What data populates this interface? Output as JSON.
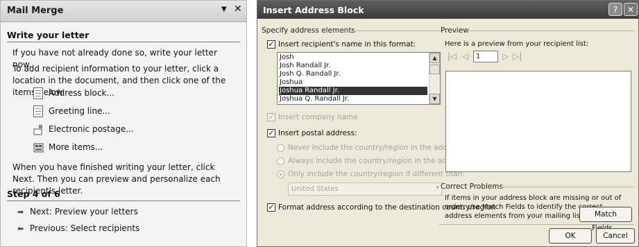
{
  "mail_merge": {
    "title": "Mail Merge",
    "dropdown_glyph": "▼",
    "close_glyph": "✕",
    "section_heading": "Write your letter",
    "p1": "If you have not already done so, write your letter now.",
    "p2": "To add recipient information to your letter, click a location in the document, and then click one of the items below.",
    "items": [
      {
        "label": "Address block...",
        "icon": "document-icon"
      },
      {
        "label": "Greeting line...",
        "icon": "document-icon"
      },
      {
        "label": "Electronic postage...",
        "icon": "postage-icon"
      },
      {
        "label": "More items...",
        "icon": "more-items-icon"
      }
    ],
    "p3": "When you have finished writing your letter, click Next. Then you can preview and personalize each recipient's letter.",
    "step_heading": "Step 4 of 6",
    "next_label": "Next: Preview your letters",
    "previous_label": "Previous: Select recipients"
  },
  "dialog": {
    "title": "Insert Address Block",
    "help_glyph": "?",
    "close_glyph": "✕",
    "specify_group": "Specify address elements",
    "insert_name_label": "Insert recipient's name in this format:",
    "name_formats": [
      "Josh",
      "Josh Randall Jr.",
      "Josh Q. Randall Jr.",
      "Joshua",
      "Joshua Randall Jr.",
      "Joshua Q. Randall Jr."
    ],
    "selected_format_index": 4,
    "insert_name_checked": true,
    "insert_company_label": "Insert company name",
    "insert_company_checked": true,
    "insert_postal_label": "Insert postal address:",
    "insert_postal_checked": true,
    "radio_never": "Never include the country/region in the address",
    "radio_always": "Always include the country/region in the address",
    "radio_only": "Only include the country/region if different than:",
    "country_value": "United States",
    "format_address_label": "Format address according to the destination country/region",
    "format_address_checked": true,
    "preview_group": "Preview",
    "preview_text": "Here is a preview from your recipient list:",
    "preview_record": "1",
    "correct_group": "Correct Problems",
    "correct_text": "If items in your address block are missing or out of order, use Match Fields to identify the correct address elements from your mailing list.",
    "match_fields_label": "Match Fields...",
    "ok_label": "OK",
    "cancel_label": "Cancel"
  }
}
